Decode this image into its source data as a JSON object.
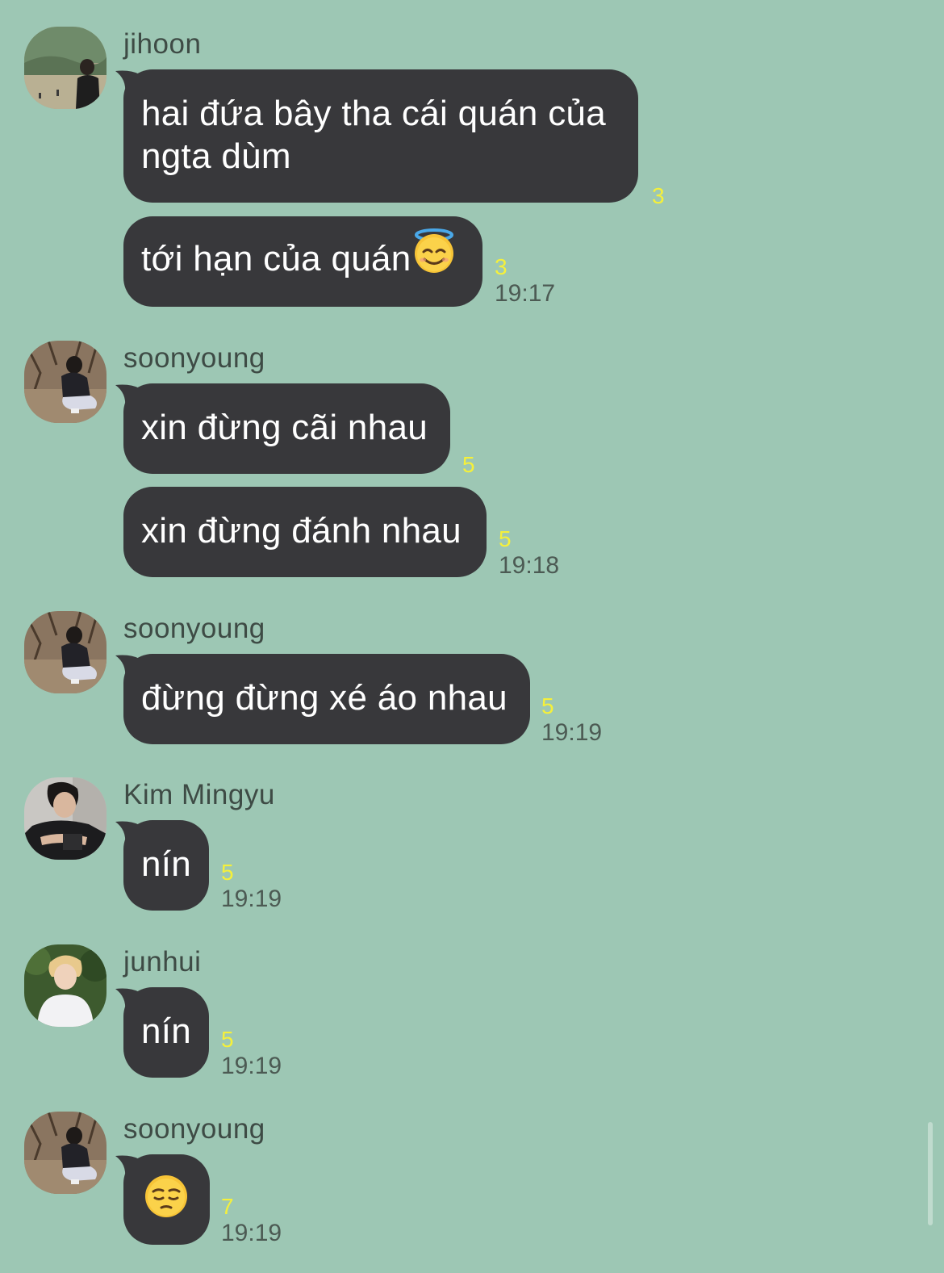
{
  "conversation": {
    "groups": [
      {
        "sender": "jihoon",
        "avatar": "jihoon-avatar",
        "messages": [
          {
            "text_lines": [
              "hai đứa bây tha cái quán của",
              "ngta dùm"
            ],
            "unread": "3",
            "time": ""
          },
          {
            "text": "tới hạn của quán",
            "emoji": "halo-smile-emoji",
            "unread": "3",
            "time": "19:17"
          }
        ]
      },
      {
        "sender": "soonyoung",
        "avatar": "soonyoung-avatar",
        "messages": [
          {
            "text": "xin đừng cãi nhau",
            "unread": "5",
            "time": ""
          },
          {
            "text": "xin đừng đánh nhau",
            "unread": "5",
            "time": "19:18"
          }
        ]
      },
      {
        "sender": "soonyoung",
        "avatar": "soonyoung-avatar",
        "messages": [
          {
            "text": "đừng đừng xé áo nhau",
            "unread": "5",
            "time": "19:19"
          }
        ]
      },
      {
        "sender": "Kim Mingyu",
        "avatar": "mingyu-avatar",
        "messages": [
          {
            "text": "nín",
            "unread": "5",
            "time": "19:19"
          }
        ]
      },
      {
        "sender": "junhui",
        "avatar": "junhui-avatar",
        "messages": [
          {
            "text": "nín",
            "unread": "5",
            "time": "19:19"
          }
        ]
      },
      {
        "sender": "soonyoung",
        "avatar": "soonyoung-avatar",
        "messages": [
          {
            "emoji": "pensive-face-emoji",
            "unread": "7",
            "time": "19:19"
          }
        ]
      }
    ]
  },
  "colors": {
    "background": "#9dc7b4",
    "bubble": "#38383b",
    "bubble_text": "#ffffff",
    "unread": "#f5f03a",
    "meta_text": "#4c5a53"
  }
}
